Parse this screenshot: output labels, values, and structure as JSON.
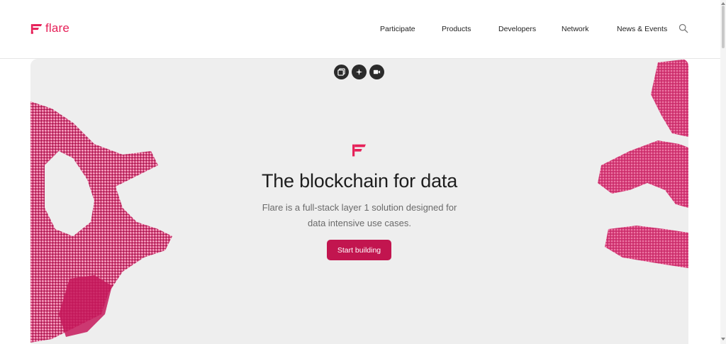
{
  "brand": {
    "name": "flare",
    "color": "#e62058"
  },
  "nav": {
    "items": [
      {
        "label": "Participate"
      },
      {
        "label": "Products"
      },
      {
        "label": "Developers"
      },
      {
        "label": "Network"
      },
      {
        "label": "News & Events"
      }
    ],
    "search_icon": "search-icon"
  },
  "hero": {
    "media_controls": [
      "gallery-icon",
      "sparkle-icon",
      "video-icon"
    ],
    "title": "The blockchain for data",
    "subtitle": "Flare is a full-stack layer 1 solution designed for data intensive use cases.",
    "cta_label": "Start building",
    "cta_color": "#c2154f",
    "background": "#eeeeee"
  }
}
